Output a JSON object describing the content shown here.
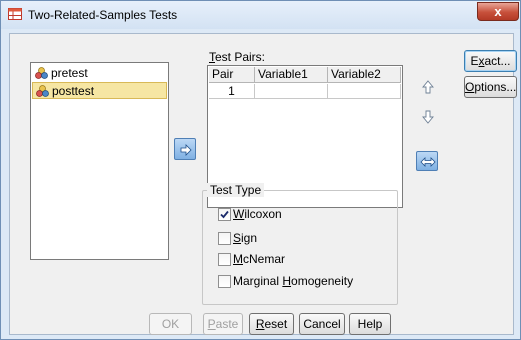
{
  "window": {
    "title": "Two-Related-Samples Tests",
    "close_glyph": "x"
  },
  "variables": {
    "items": [
      {
        "label": "pretest",
        "icon": "scale-variable-icon",
        "selected": false
      },
      {
        "label": "posttest",
        "icon": "scale-variable-icon",
        "selected": true
      }
    ]
  },
  "test_pairs": {
    "label_prefix": "T",
    "label_rest": "est Pairs:",
    "columns": [
      "Pair",
      "Variable1",
      "Variable2"
    ],
    "rows": [
      {
        "pair": "1",
        "variable1": "",
        "variable2": ""
      }
    ]
  },
  "side_buttons": {
    "exact_pre": "E",
    "exact_u": "x",
    "exact_post": "act...",
    "options_pre": "",
    "options_u": "O",
    "options_post": "ptions..."
  },
  "test_type": {
    "title": "Test Type",
    "options": [
      {
        "pre": "",
        "u": "W",
        "post": "ilcoxon",
        "checked": true
      },
      {
        "pre": "",
        "u": "S",
        "post": "ign",
        "checked": false
      },
      {
        "pre": "",
        "u": "M",
        "post": "cNemar",
        "checked": false
      },
      {
        "pre": "Marginal ",
        "u": "H",
        "post": "omogeneity",
        "checked": false
      }
    ]
  },
  "footer": {
    "ok": "OK",
    "paste_u": "P",
    "paste_post": "aste",
    "reset_u": "R",
    "reset_post": "eset",
    "cancel": "Cancel",
    "help": "Help"
  },
  "colors": {
    "selected_row": "#f6e6a3",
    "accent_blue": "#7fb0e3",
    "close_red": "#c7503b"
  }
}
